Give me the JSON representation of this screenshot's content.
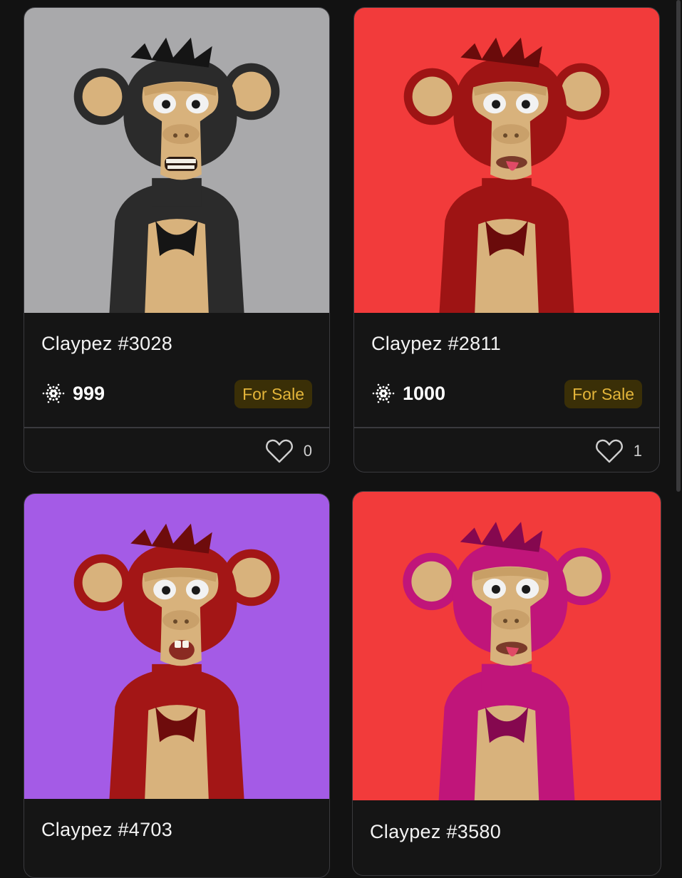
{
  "cards": [
    {
      "name": "Claypez #3028",
      "price": "999",
      "status": "For Sale",
      "likes": "0",
      "bg": "#a9a9ab",
      "fur": "#2b2b2b",
      "furDark": "#151515",
      "mouth": "teeth"
    },
    {
      "name": "Claypez #2811",
      "price": "1000",
      "status": "For Sale",
      "likes": "1",
      "bg": "#f23b3b",
      "fur": "#9e1414",
      "furDark": "#6a0b0b",
      "mouth": "tongue"
    },
    {
      "name": "Claypez #4703",
      "bg": "#a45be6",
      "fur": "#a31616",
      "furDark": "#6e0c0c",
      "mouth": "open"
    },
    {
      "name": "Claypez #3580",
      "bg": "#f23b3b",
      "fur": "#c0157a",
      "furDark": "#85084f",
      "mouth": "tongue"
    }
  ],
  "icons": {
    "currency": "cardano-ada-icon",
    "like": "heart-outline-icon"
  },
  "colors": {
    "page_bg": "#121212",
    "card_bg": "#151515",
    "badge_bg": "#3a2f07",
    "badge_text": "#e3b53a"
  }
}
